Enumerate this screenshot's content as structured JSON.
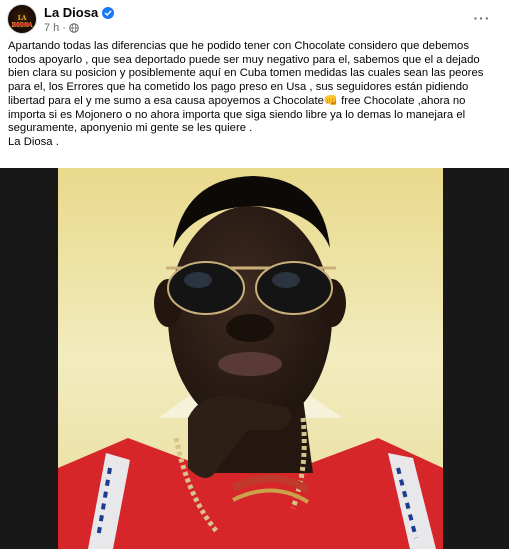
{
  "post": {
    "author": "La Diosa",
    "avatar_text": "LA DIOSA",
    "time": "7 h",
    "more_label": "···",
    "lines": [
      "Apartando todas las diferencias que he podido tener con Chocolate considero que debemos",
      "todos apoyarlo , que sea deportado puede ser muy negativo para el, sabemos que el a dejado",
      "bien clara su posicion y posiblemente aquí en Cuba tomen medidas las cuales sean las peores",
      "para el, los Errores que ha cometido los pago preso en Usa , sus seguidores están pidiendo",
      "libertad para el y me sumo a esa causa apoyemos a Chocolate👊 free Chocolate ,ahora no",
      "importa si es Mojonero o no ahora importa que siga siendo libre ya lo demas lo manejara el",
      "seguramente, aponyenio mi gente se les quiere .",
      "La Diosa ."
    ]
  },
  "icons": {
    "verified": "verified-badge-icon",
    "privacy": "globe-icon",
    "more": "more-options-icon"
  },
  "colors": {
    "verified": "#1877f2",
    "meta_text": "#65676b",
    "photo_bg": "#efe6a4",
    "shirt": "#d6262a",
    "media_bg": "#181818"
  }
}
